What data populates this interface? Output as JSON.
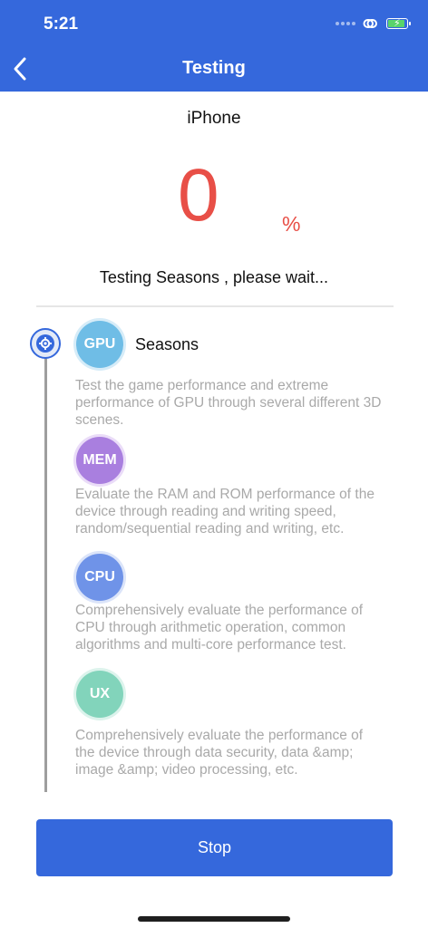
{
  "status_bar": {
    "time": "5:21"
  },
  "header": {
    "title": "Testing"
  },
  "device": {
    "name": "iPhone"
  },
  "progress": {
    "value": "0",
    "unit": "%"
  },
  "status_text": "Testing Seasons  , please wait...",
  "tests": [
    {
      "badge": "GPU",
      "name": "Seasons",
      "desc": "Test the game performance and extreme performance of GPU through several different 3D scenes."
    },
    {
      "badge": "MEM",
      "desc": "Evaluate the RAM and ROM performance of the device through reading and writing speed, random/sequential reading and writing, etc."
    },
    {
      "badge": "CPU",
      "desc": "Comprehensively evaluate the performance of CPU through arithmetic operation, common algorithms and multi-core performance test."
    },
    {
      "badge": "UX",
      "desc": "Comprehensively evaluate the performance of the device through data security, data &amp; image &amp; video processing, etc."
    }
  ],
  "actions": {
    "stop_label": "Stop"
  },
  "colors": {
    "accent": "#3568dc",
    "percent": "#e84f47",
    "gpu": "#6fbde6",
    "mem": "#a97fdf",
    "cpu": "#6f93e8",
    "ux": "#82d4bb"
  }
}
